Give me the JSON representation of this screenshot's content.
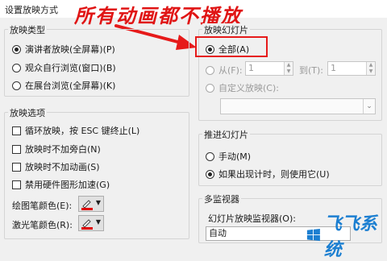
{
  "window": {
    "title": "设置放映方式"
  },
  "annotation": {
    "text": "所有动画都不播放"
  },
  "show_type": {
    "legend": "放映类型",
    "options": [
      {
        "label": "演讲者放映(全屏幕)(P)",
        "selected": true
      },
      {
        "label": "观众自行浏览(窗口)(B)",
        "selected": false
      },
      {
        "label": "在展台浏览(全屏幕)(K)",
        "selected": false
      }
    ]
  },
  "show_options": {
    "legend": "放映选项",
    "checkboxes": [
      {
        "label": "循环放映，按 ESC 键终止(L)",
        "checked": false
      },
      {
        "label": "放映时不加旁白(N)",
        "checked": false
      },
      {
        "label": "放映时不加动画(S)",
        "checked": false
      },
      {
        "label": "禁用硬件图形加速(G)",
        "checked": false
      }
    ],
    "pen_color_label": "绘图笔颜色(E):",
    "laser_color_label": "激光笔颜色(R):",
    "pen_color": "#e00000",
    "laser_color": "#e00000"
  },
  "show_slides": {
    "legend": "放映幻灯片",
    "all_label": "全部(A)",
    "from_label": "从(F):",
    "from_value": "1",
    "to_label": "到(T):",
    "to_value": "1",
    "custom_label": "自定义放映(C):"
  },
  "advance": {
    "legend": "推进幻灯片",
    "options": [
      {
        "label": "手动(M)",
        "selected": false
      },
      {
        "label": "如果出现计时，则使用它(U)",
        "selected": true
      }
    ]
  },
  "monitors": {
    "legend": "多监视器",
    "monitor_label": "幻灯片放映监视器(O):",
    "monitor_value": "自动"
  },
  "watermark": {
    "text": "飞飞系统"
  },
  "colors": {
    "annotation": "#e61a1a",
    "watermark": "#1c7fd1"
  }
}
